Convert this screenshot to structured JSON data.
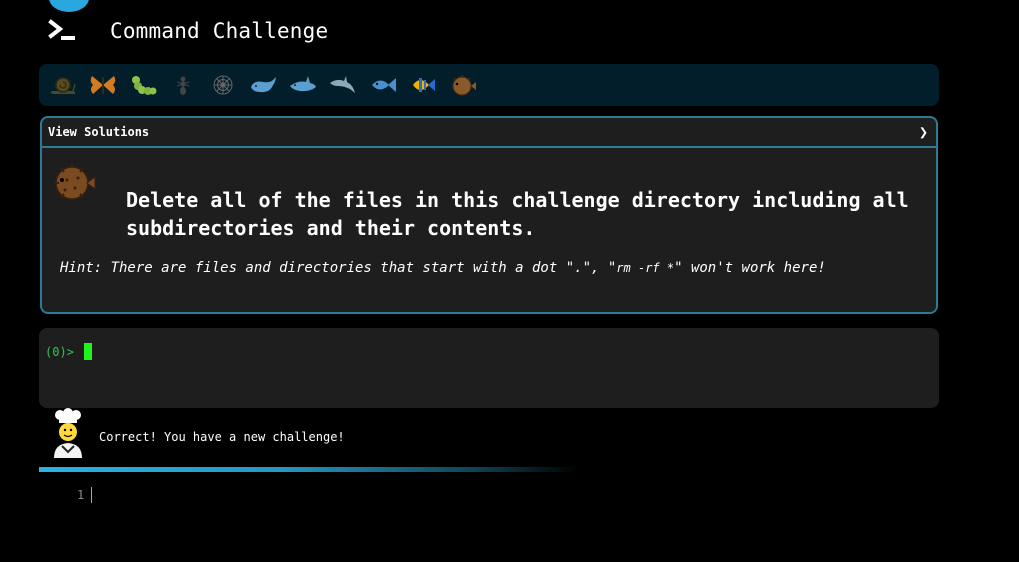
{
  "header": {
    "title": "Command Challenge",
    "logo_icon": "terminal-prompt-icon"
  },
  "emoji_bar": {
    "items": [
      "snail",
      "butterfly",
      "caterpillar",
      "ant",
      "spider-web",
      "whale",
      "shark",
      "dolphin",
      "fish",
      "tropical-fish",
      "blowfish"
    ]
  },
  "challenge": {
    "solutions_label": "View Solutions",
    "toggle_glyph": "❯",
    "avatar_icon": "blowfish",
    "description": "Delete all of the files in this challenge directory including all subdirectories and their contents.",
    "hint_prefix": "Hint: There are files and directories that start with a dot \".\", \"",
    "hint_code": "rm -rf *",
    "hint_suffix": "\" won't work here!"
  },
  "terminal": {
    "prompt": "(0)> "
  },
  "status": {
    "avatar_icon": "chef",
    "message": "Correct! You have a new challenge!"
  },
  "editor": {
    "line_number": "1"
  },
  "colors": {
    "accent": "#29a8df",
    "panel_border": "#2a7b93",
    "prompt_green": "#2ec74f",
    "cursor_green": "#1ef51e"
  }
}
